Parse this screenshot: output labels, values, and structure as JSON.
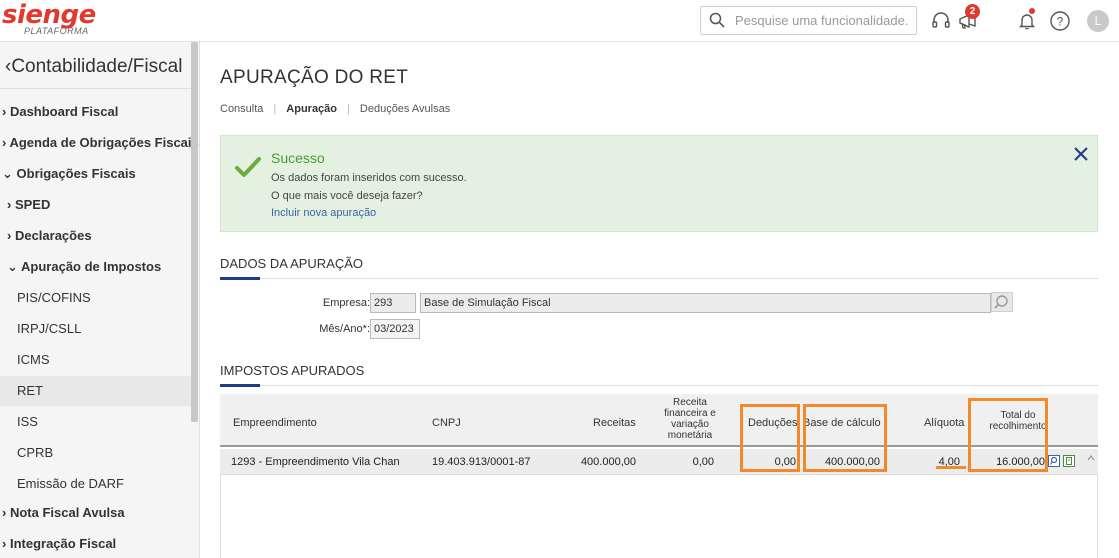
{
  "header": {
    "logo_text": "sienge",
    "logo_sub": "PLATAFORMA",
    "search_placeholder": "Pesquise uma funcionalidade.",
    "notification_count": "2",
    "avatar_letter": "L"
  },
  "sidebar": {
    "title": "Contabilidade/Fiscal",
    "items": [
      {
        "label": "Dashboard Fiscal"
      },
      {
        "label": "Agenda de Obrigações Fiscais"
      },
      {
        "label": "Obrigações Fiscais"
      },
      {
        "label": "SPED"
      },
      {
        "label": "Declarações"
      },
      {
        "label": "Apuração de Impostos"
      },
      {
        "label": "PIS/COFINS"
      },
      {
        "label": "IRPJ/CSLL"
      },
      {
        "label": "ICMS"
      },
      {
        "label": "RET"
      },
      {
        "label": "ISS"
      },
      {
        "label": "CPRB"
      },
      {
        "label": "Emissão de DARF"
      },
      {
        "label": "Nota Fiscal Avulsa"
      },
      {
        "label": "Integração Fiscal"
      }
    ]
  },
  "main": {
    "page_title": "APURAÇÃO DO RET",
    "tabs": [
      {
        "label": "Consulta"
      },
      {
        "label": "Apuração"
      },
      {
        "label": "Deduções Avulsas"
      }
    ],
    "success": {
      "title": "Sucesso",
      "line1": "Os dados foram inseridos com sucesso.",
      "line2": "O que mais você deseja fazer?",
      "link": "Incluir nova apuração"
    },
    "dados": {
      "section_title": "DADOS DA APURAÇÃO",
      "empresa_label": "Empresa:",
      "empresa_code": "293",
      "empresa_name": "Base de Simulação Fiscal",
      "mes_label": "Mês/Ano*:",
      "mes_value": "03/2023"
    },
    "impostos": {
      "section_title": "IMPOSTOS APURADOS",
      "columns": {
        "empreendimento": "Empreendimento",
        "cnpj": "CNPJ",
        "receitas": "Receitas",
        "receita_fin_1": "Receita",
        "receita_fin_2": "financeira e",
        "receita_fin_3": "variação",
        "receita_fin_4": "monetária",
        "deducoes": "Deduções",
        "base": "Base de cálculo",
        "aliquota": "Alíquota",
        "total_1": "Total do",
        "total_2": "recolhimento"
      },
      "rows": [
        {
          "empreendimento": "1293 - Empreendimento Vila Chan",
          "cnpj": "19.403.913/0001-87",
          "receitas": "400.000,00",
          "receita_fin": "0,00",
          "deducoes": "0,00",
          "base": "400.000,00",
          "aliquota": "4,00",
          "total": "16.000,00"
        }
      ]
    }
  },
  "colors": {
    "brand": "#e03a2f",
    "highlight": "#f08a2c",
    "success_bg": "#e4f1e0",
    "section_accent": "#1f3c88"
  }
}
